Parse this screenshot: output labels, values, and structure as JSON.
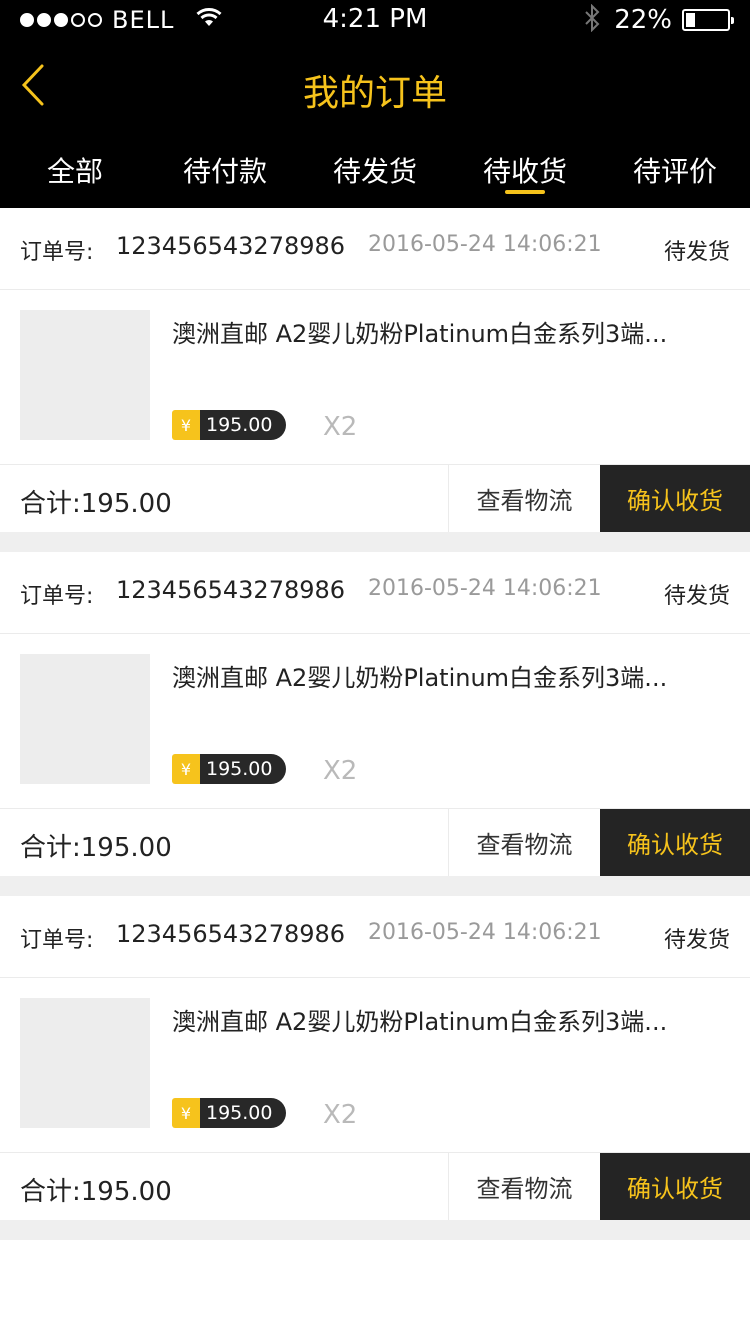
{
  "status_bar": {
    "carrier": "BELL",
    "time": "4:21 PM",
    "battery_percent": "22%",
    "battery_level": 0.22,
    "signal_dots_filled": 3,
    "signal_dots_total": 5,
    "icons": [
      "wifi-icon",
      "bluetooth-icon",
      "battery-icon"
    ]
  },
  "header": {
    "title": "我的订单",
    "back_icon": "chevron-left-icon"
  },
  "tabs": [
    {
      "label": "全部",
      "active": false
    },
    {
      "label": "待付款",
      "active": false
    },
    {
      "label": "待发货",
      "active": false
    },
    {
      "label": "待收货",
      "active": true
    },
    {
      "label": "待评价",
      "active": false
    }
  ],
  "orders": [
    {
      "order_no_label": "订单号:",
      "order_no": "123456543278986",
      "date": "2016-05-24 14:06:21",
      "status": "待发货",
      "product_name": "澳洲直邮 A2婴儿奶粉Platinum白金系列3端...",
      "currency_symbol": "¥",
      "price": "195.00",
      "quantity": "X2",
      "total_text": "合计:195.00",
      "logistics_label": "查看物流",
      "confirm_label": "确认收货"
    },
    {
      "order_no_label": "订单号:",
      "order_no": "123456543278986",
      "date": "2016-05-24 14:06:21",
      "status": "待发货",
      "product_name": "澳洲直邮 A2婴儿奶粉Platinum白金系列3端...",
      "currency_symbol": "¥",
      "price": "195.00",
      "quantity": "X2",
      "total_text": "合计:195.00",
      "logistics_label": "查看物流",
      "confirm_label": "确认收货"
    },
    {
      "order_no_label": "订单号:",
      "order_no": "123456543278986",
      "date": "2016-05-24 14:06:21",
      "status": "待发货",
      "product_name": "澳洲直邮 A2婴儿奶粉Platinum白金系列3端...",
      "currency_symbol": "¥",
      "price": "195.00",
      "quantity": "X2",
      "total_text": "合计:195.00",
      "logistics_label": "查看物流",
      "confirm_label": "确认收货"
    }
  ],
  "colors": {
    "accent": "#f6c31c",
    "bar_background": "#000000",
    "confirm_button": "#242424",
    "divider": "#efefef"
  }
}
